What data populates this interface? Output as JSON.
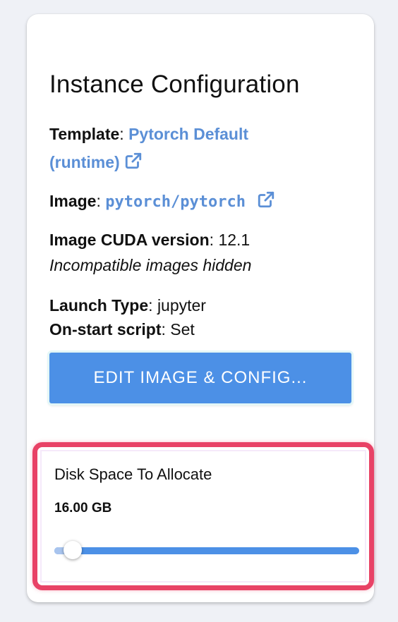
{
  "card": {
    "title": "Instance Configuration",
    "template": {
      "label": "Template",
      "value_line1": "Pytorch Default",
      "value_line2": "(runtime)"
    },
    "image": {
      "label": "Image",
      "value": "pytorch/pytorch"
    },
    "cuda": {
      "label": "Image CUDA version",
      "value": "12.1",
      "note": "Incompatible images hidden"
    },
    "launch_type": {
      "label": "Launch Type",
      "value": "jupyter"
    },
    "onstart": {
      "label": "On-start script",
      "value": "Set"
    },
    "edit_button_label": "EDIT IMAGE & CONFIG..."
  },
  "disk": {
    "label": "Disk Space To Allocate",
    "value": "16.00 GB",
    "slider_fraction": 0.06
  },
  "icons": {
    "external_link": "external-link-icon"
  },
  "colors": {
    "link": "#5b8fd6",
    "button": "#4c90e6",
    "highlight": "#e84266"
  }
}
